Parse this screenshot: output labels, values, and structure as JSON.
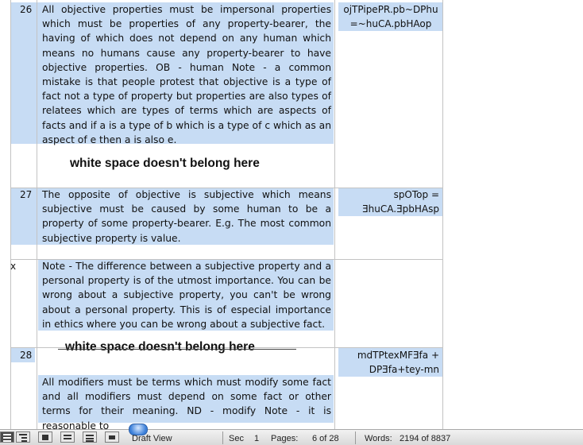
{
  "document": {
    "rows": [
      {
        "number": "26",
        "body": "All objective properties must be impersonal properties which must be properties of any property-bearer, the having of which does not depend on any human which means no humans cause any property-bearer to have objective properties. OB - human  Note - a common mistake is that people protest that objective is a type of fact not a type of property but properties are also types of relatees which are types of terms which are aspects of facts and if a is a type of b which is a type of c which as an aspect of e then a is also e.",
        "code": "ojTPipePR.pb~DPhu=~huCA.pbHAop",
        "code_lines": [
          "ojTPipePR.pb~DPhu",
          "=~huCA.pbHAop"
        ],
        "annotation": "white space doesn't belong here"
      },
      {
        "number": "27",
        "body": "The opposite of objective is subjective which means subjective must be caused by some human to be a property of some property-bearer.  E.g. The most common subjective property is value.",
        "code_lines": [
          "spOTop =",
          "ƎhuCA.ƎpbHAsp"
        ]
      },
      {
        "number": "x",
        "body": "Note - The difference between a subjective property and a personal property is of the utmost importance.  You can be wrong about a subjective property, you can't be wrong about a personal property.  This is of especial importance in ethics where you can be wrong about a subjective fact."
      },
      {
        "number": "28",
        "annotation": "white space doesn't belong here",
        "code_lines": [
          "mdTPtexMFƎfa +",
          "DPƎfa+tey-mn"
        ],
        "body": "All modifiers must be terms which must modify some fact and all modifiers must depend on some fact or other terms for their meaning. ND - modify  Note - it is reasonable to"
      }
    ]
  },
  "statusbar": {
    "view_label": "Draft View",
    "sec_label": "Sec",
    "sec_value": "1",
    "pages_label": "Pages:",
    "pages_value": "6 of 28",
    "words_label": "Words:",
    "words_value": "2194 of 8837",
    "view_buttons": [
      "draft-view",
      "outline-view",
      "publishing-layout-view",
      "print-layout-view",
      "notebook-layout-view",
      "full-screen-view"
    ]
  }
}
